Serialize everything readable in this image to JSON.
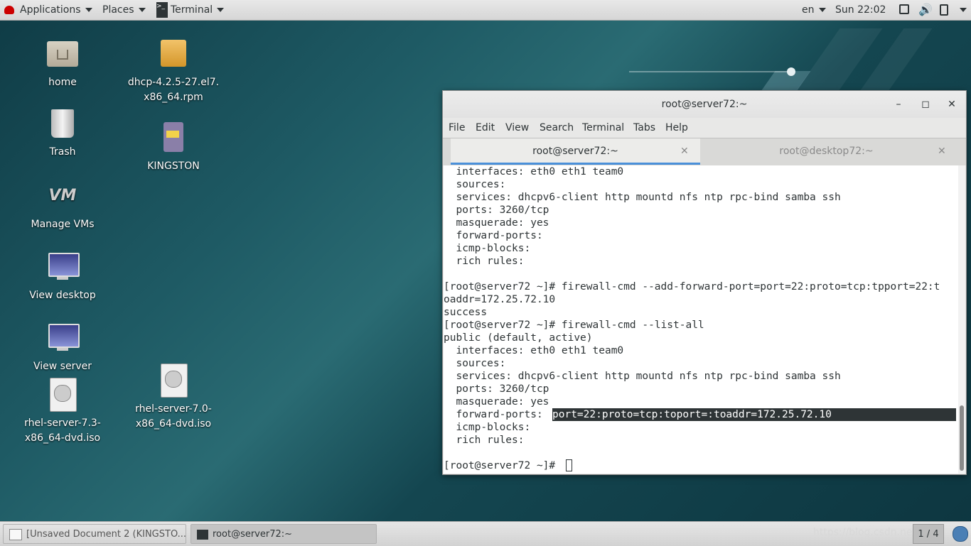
{
  "topbar": {
    "applications": "Applications",
    "places": "Places",
    "terminal": "Terminal",
    "language": "en",
    "clock": "Sun 22:02"
  },
  "desktop_icons": [
    {
      "label": "home",
      "icon": "home-folder-icon"
    },
    {
      "label": "Trash",
      "icon": "trash-icon"
    },
    {
      "label": "Manage VMs",
      "icon": "vm-icon"
    },
    {
      "label": "View desktop",
      "icon": "monitor-icon"
    },
    {
      "label": "View server",
      "icon": "monitor-icon"
    },
    {
      "label": "rhel-server-7.3-\nx86_64-dvd.iso",
      "icon": "disc-image-icon"
    },
    {
      "label": "dhcp-4.2.5-27.el7.\nx86_64.rpm",
      "icon": "package-icon"
    },
    {
      "label": "KINGSTON",
      "icon": "usb-drive-icon"
    },
    {
      "label": "rhel-server-7.0-\nx86_64-dvd.iso",
      "icon": "disc-image-icon"
    }
  ],
  "terminal_window": {
    "title": "root@server72:~",
    "menu": [
      "File",
      "Edit",
      "View",
      "Search",
      "Terminal",
      "Tabs",
      "Help"
    ],
    "tabs": [
      {
        "label": "root@server72:~",
        "active": true
      },
      {
        "label": "root@desktop72:~",
        "active": false
      }
    ],
    "lines": [
      "  interfaces: eth0 eth1 team0",
      "  sources: ",
      "  services: dhcpv6-client http mountd nfs ntp rpc-bind samba ssh",
      "  ports: 3260/tcp",
      "  masquerade: yes",
      "  forward-ports: ",
      "  icmp-blocks: ",
      "  rich rules: ",
      "",
      "[root@server72 ~]# firewall-cmd --add-forward-port=port=22:proto=tcp:tpport=22:t",
      "oaddr=172.25.72.10",
      "success",
      "[root@server72 ~]# firewall-cmd --list-all",
      "public (default, active)",
      "  interfaces: eth0 eth1 team0",
      "  sources: ",
      "  services: dhcpv6-client http mountd nfs ntp rpc-bind samba ssh",
      "  ports: 3260/tcp",
      "  masquerade: yes",
      "  forward-ports: ",
      "  icmp-blocks: ",
      "  rich rules: ",
      "",
      "[root@server72 ~]# "
    ],
    "highlighted_text": "port=22:proto=tcp:toport=:toaddr=172.25.72.10"
  },
  "taskbar": {
    "items": [
      {
        "label": "[Unsaved Document 2 (KINGSTO...",
        "active": false
      },
      {
        "label": "root@server72:~",
        "active": true
      }
    ],
    "workspace": "1 / 4",
    "watermark": "https://blog.csdn.net/..."
  }
}
